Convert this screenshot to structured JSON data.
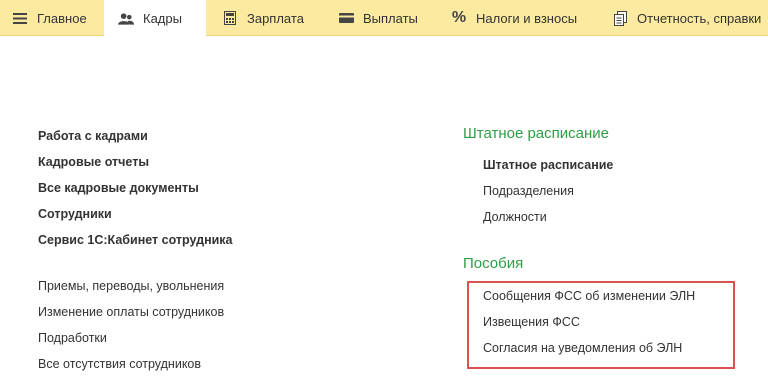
{
  "nav": {
    "tabs": [
      {
        "label": "Главное",
        "icon": "menu-icon"
      },
      {
        "label": "Кадры",
        "icon": "people-icon"
      },
      {
        "label": "Зарплата",
        "icon": "calculator-icon"
      },
      {
        "label": "Выплаты",
        "icon": "wallet-icon"
      },
      {
        "label": "Налоги и взносы",
        "icon": "percent-icon"
      },
      {
        "label": "Отчетность, справки",
        "icon": "documents-icon"
      }
    ],
    "active_tab": "Кадры"
  },
  "left": {
    "bold_links": [
      "Работа с кадрами",
      "Кадровые отчеты",
      "Все кадровые документы",
      "Сотрудники",
      "Сервис 1С:Кабинет сотрудника"
    ],
    "links": [
      "Приемы, переводы, увольнения",
      "Изменение оплаты сотрудников",
      "Подработки",
      "Все отсутствия сотрудников"
    ]
  },
  "right": {
    "staffing": {
      "title": "Штатное расписание",
      "items": [
        "Штатное расписание",
        "Подразделения",
        "Должности"
      ]
    },
    "benefits": {
      "title": "Пособия",
      "items": [
        "Сообщения ФСС об изменении ЭЛН",
        "Извещения ФСС",
        "Согласия на уведомления об ЭЛН"
      ]
    }
  },
  "colors": {
    "nav_bg": "#fbeaa0",
    "section_title": "#2e9e44",
    "highlight_border": "#d9534f"
  }
}
